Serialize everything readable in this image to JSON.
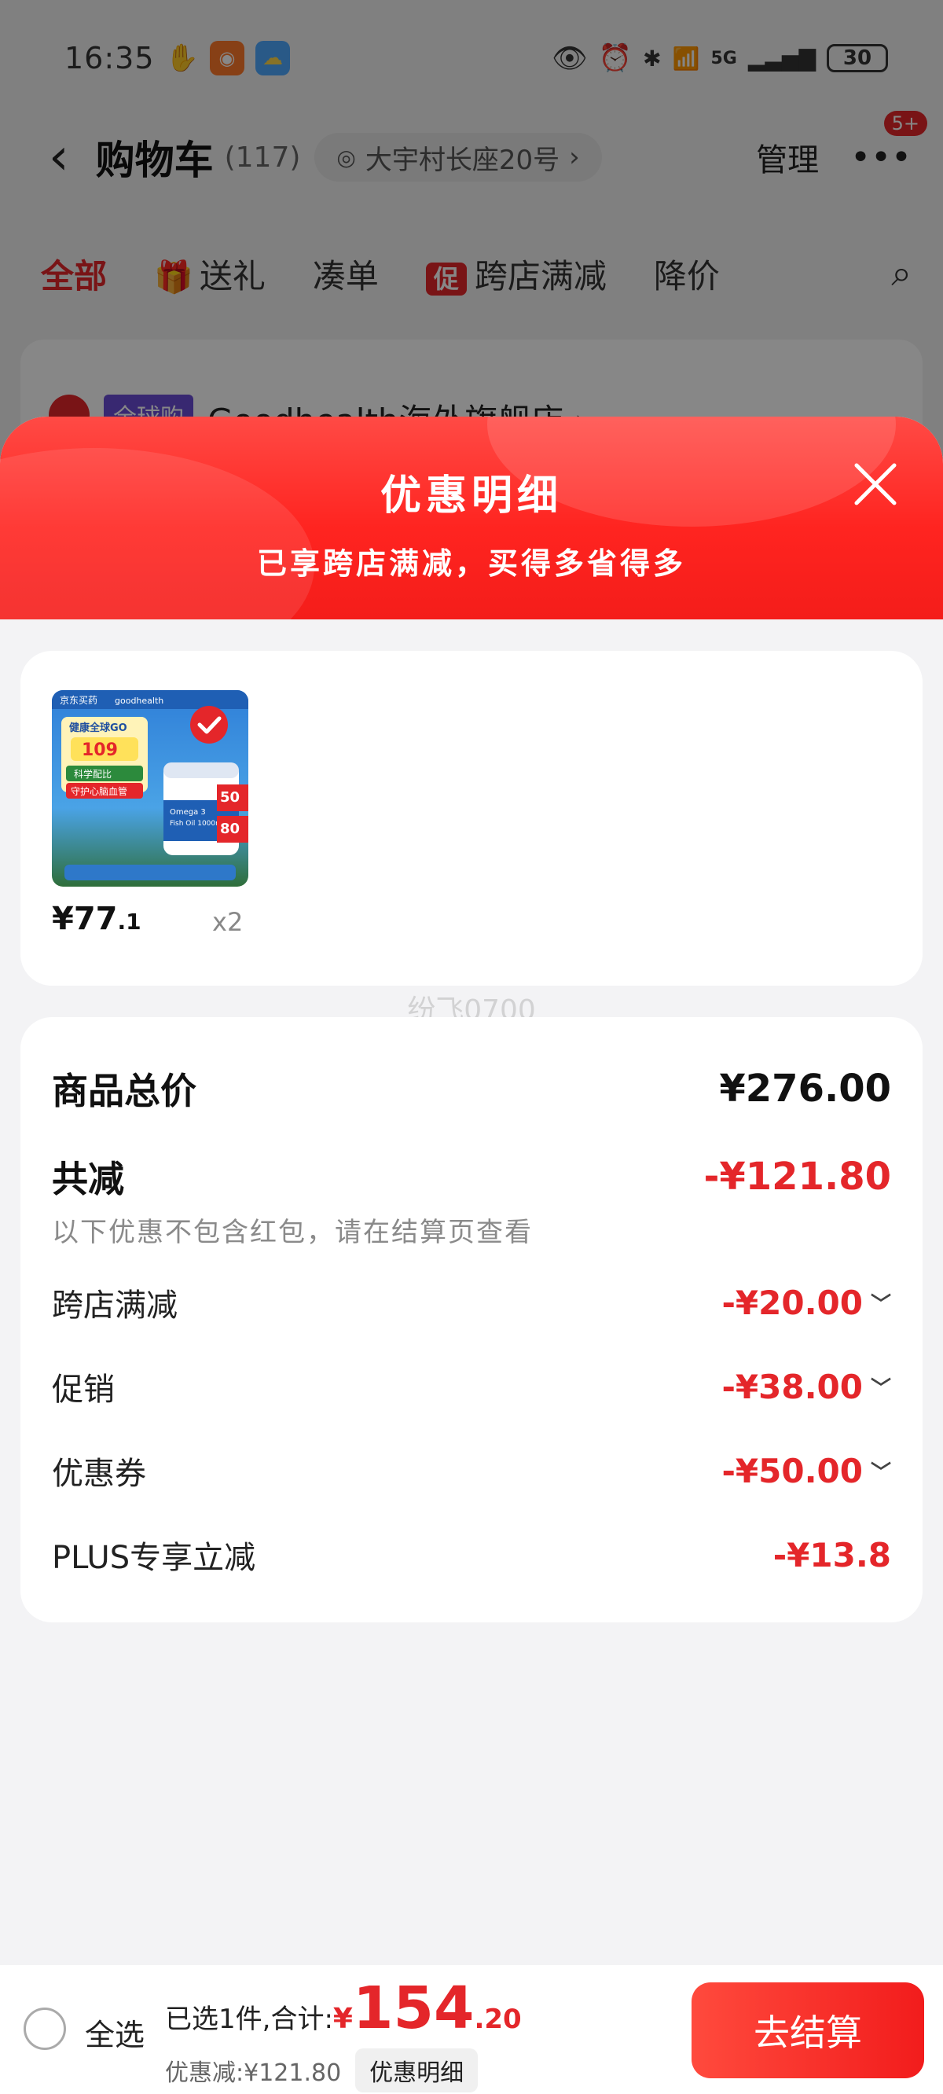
{
  "status_bar": {
    "time": "16:35",
    "network": "5G",
    "battery": "30"
  },
  "nav": {
    "title": "购物车",
    "count": "(117)",
    "address": "大宇村长座20号",
    "manage": "管理",
    "badge": "5+"
  },
  "tabs": [
    {
      "label": "全部",
      "icon": ""
    },
    {
      "label": "送礼",
      "icon": "gift-icon"
    },
    {
      "label": "凑单",
      "icon": ""
    },
    {
      "label": "跨店满减",
      "icon": "promo-tag-icon",
      "icon_text": "促"
    },
    {
      "label": "降价",
      "icon": ""
    }
  ],
  "store": {
    "tag": "全球购",
    "name": "Goodhealth海外旗舰店 ›"
  },
  "sheet": {
    "title": "优惠明细",
    "subtitle": "已享跨店满减，买得多省得多"
  },
  "product": {
    "price_int": "¥77",
    "price_dec": ".1",
    "qty": "x2",
    "image_promo_price": "109",
    "image_brand": "goodhealth",
    "image_name": "Omega 3 Fish Oil 1000mg"
  },
  "watermark": "纷飞0700",
  "summary": {
    "total_label": "商品总价",
    "total_value": "¥276.00",
    "reduce_label": "共减",
    "reduce_value": "-¥121.80",
    "note": "以下优惠不包含红包，请在结算页查看",
    "items": [
      {
        "label": "跨店满减",
        "value": "-¥20.00",
        "expandable": true
      },
      {
        "label": "促销",
        "value": "-¥38.00",
        "expandable": true
      },
      {
        "label": "优惠券",
        "value": "-¥50.00",
        "expandable": true
      },
      {
        "label": "PLUS专享立减",
        "value": "-¥13.8",
        "expandable": false
      }
    ]
  },
  "bottom": {
    "select_all": "全选",
    "selected_label": "已选1件,合计:",
    "currency": "¥",
    "total_int": "154",
    "total_dec": ".20",
    "discount_text": "优惠减:¥121.80",
    "detail_button": "优惠明细",
    "checkout_button": "去结算"
  },
  "colors": {
    "accent": "#e4262a",
    "header_red": "#ff2420"
  }
}
